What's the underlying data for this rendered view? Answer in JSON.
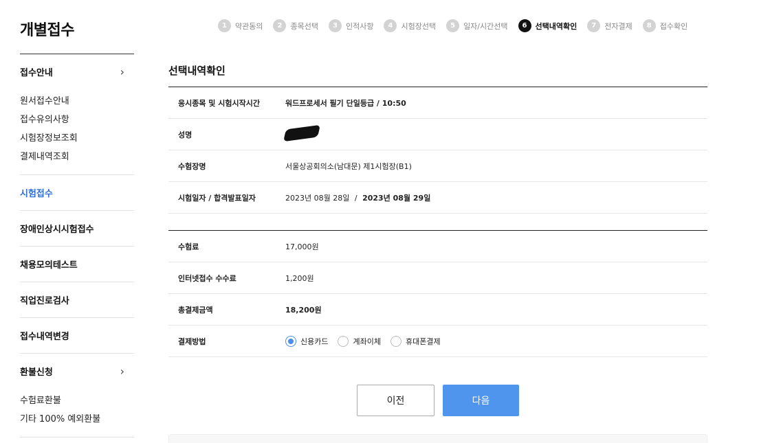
{
  "page": {
    "title": "개별접수"
  },
  "steps": [
    {
      "num": "1",
      "label": "약관동의"
    },
    {
      "num": "2",
      "label": "종목선택"
    },
    {
      "num": "3",
      "label": "인적사항"
    },
    {
      "num": "4",
      "label": "시험장선택"
    },
    {
      "num": "5",
      "label": "일자/시간선택"
    },
    {
      "num": "6",
      "label": "선택내역확인"
    },
    {
      "num": "7",
      "label": "전자결제"
    },
    {
      "num": "8",
      "label": "접수확인"
    }
  ],
  "active_step": "6",
  "sidebar": {
    "groups": [
      {
        "label": "접수안내",
        "chevron": "›",
        "items": [
          "원서접수안내",
          "접수유의사항",
          "시험장정보조회",
          "결제내역조회"
        ]
      },
      {
        "label": "시험접수"
      },
      {
        "label": "장애인상시시험접수"
      },
      {
        "label": "채용모의테스트"
      },
      {
        "label": "직업진로검사"
      },
      {
        "label": "접수내역변경"
      },
      {
        "label": "환불신청",
        "chevron": "›",
        "items": [
          "수험료환불",
          "기타 100% 예외환불"
        ]
      }
    ]
  },
  "section": {
    "title": "선택내역확인"
  },
  "details": {
    "exam": {
      "label": "응시종목 및 시험시작시간",
      "value": "워드프로세서 필기 단일등급 / 10:50"
    },
    "name": {
      "label": "성명"
    },
    "venue": {
      "label": "수험장명",
      "value": "서울상공회의소(남대문) 제1시험장(B1)"
    },
    "dates": {
      "label": "시험일자 / 합격발표일자",
      "exam_date": "2023년 08월 28일",
      "sep": "/",
      "result_date": "2023년 08월 29일"
    }
  },
  "payment": {
    "fee": {
      "label": "수험료",
      "value": "17,000원"
    },
    "online_fee": {
      "label": "인터넷접수 수수료",
      "value": "1,200원"
    },
    "total": {
      "label": "총결제금액",
      "value": "18,200원"
    },
    "method": {
      "label": "결제방법",
      "options": [
        "신용카드",
        "계좌이체",
        "휴대폰결제"
      ],
      "selected": "신용카드"
    }
  },
  "buttons": {
    "prev": "이전",
    "next": "다음"
  },
  "colors": {
    "accent": "#4f95ee",
    "active_side": "#2f6fd8"
  }
}
